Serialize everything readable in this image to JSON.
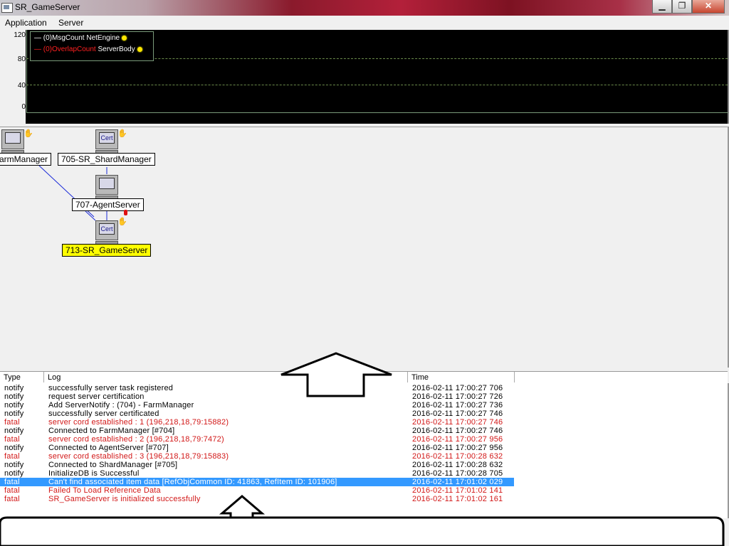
{
  "window": {
    "title": "SR_GameServer",
    "minimize": "▁",
    "maximize": "❐",
    "close": "✕"
  },
  "menu": [
    "Application",
    "Server"
  ],
  "graph": {
    "yticks": [
      "120",
      "80",
      "40",
      "0"
    ],
    "legend": [
      {
        "prefix": "—",
        "name": "(0)MsgCount",
        "source": "NetEngine",
        "color": "#ffffff"
      },
      {
        "prefix": "—",
        "name": "(0)OverlapCount",
        "source": "ServerBody",
        "color": "#ff2020"
      }
    ]
  },
  "nodes": [
    {
      "label": "armManager",
      "icon": "computer-icon",
      "screen": ""
    },
    {
      "label": "705-SR_ShardManager",
      "icon": "cert-computer-icon",
      "screen": "Cert"
    },
    {
      "label": "707-AgentServer",
      "icon": "computer-icon",
      "screen": ""
    },
    {
      "label": "713-SR_GameServer",
      "icon": "cert-computer-icon",
      "screen": "Cert",
      "selected": true
    }
  ],
  "log": {
    "columns": [
      "Type",
      "Log",
      "Time"
    ],
    "rows": [
      {
        "type": "notify",
        "log": "successfully server task registered",
        "time": "2016-02-11 17:00:27 706"
      },
      {
        "type": "notify",
        "log": "request server certification",
        "time": "2016-02-11 17:00:27 726"
      },
      {
        "type": "notify",
        "log": "Add ServerNotify : (704) - FarmManager",
        "time": "2016-02-11 17:00:27 736"
      },
      {
        "type": "notify",
        "log": "successfully server certificated",
        "time": "2016-02-11 17:00:27 746"
      },
      {
        "type": "fatal",
        "log": "server cord established : 1 (196,218,18,79:15882)",
        "time": "2016-02-11 17:00:27 746"
      },
      {
        "type": "notify",
        "log": "Connected to FarmManager [#704]",
        "time": "2016-02-11 17:00:27 746"
      },
      {
        "type": "fatal",
        "log": "server cord established : 2 (196,218,18,79:7472)",
        "time": "2016-02-11 17:00:27 956"
      },
      {
        "type": "notify",
        "log": "Connected to AgentServer [#707]",
        "time": "2016-02-11 17:00:27 956"
      },
      {
        "type": "fatal",
        "log": "server cord established : 3 (196,218,18,79:15883)",
        "time": "2016-02-11 17:00:28 632"
      },
      {
        "type": "notify",
        "log": "Connected to ShardManager [#705]",
        "time": "2016-02-11 17:00:28 632"
      },
      {
        "type": "notify",
        "log": "InitializeDB is Successful",
        "time": "2016-02-11 17:00:28 705"
      },
      {
        "type": "fatal",
        "log": "Can't find associated item data [RefObjCommon ID: 41863, RefItem ID: 101906]",
        "time": "2016-02-11 17:01:02 029",
        "selected": true
      },
      {
        "type": "fatal",
        "log": "Failed To Load Reference Data",
        "time": "2016-02-11 17:01:02 141"
      },
      {
        "type": "fatal",
        "log": "SR_GameServer is initialized successfully",
        "time": "2016-02-11 17:01:02 161"
      }
    ]
  }
}
